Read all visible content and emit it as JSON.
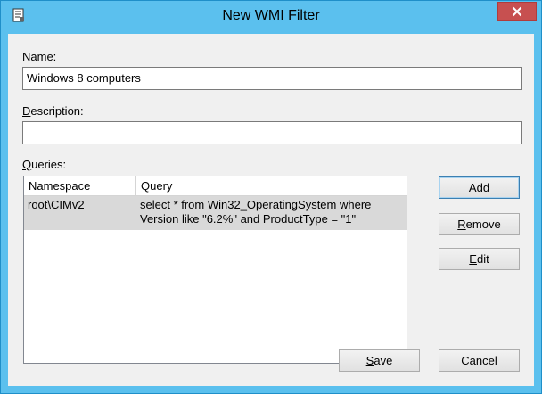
{
  "window": {
    "title": "New WMI Filter",
    "close_label": "✕"
  },
  "form": {
    "name_label_underlined": "N",
    "name_label_rest": "ame:",
    "name_value": "Windows 8 computers",
    "description_label_underlined": "D",
    "description_label_rest": "escription:",
    "description_value": "",
    "queries_label_underlined": "Q",
    "queries_label_rest": "ueries:"
  },
  "queries": {
    "columns": [
      "Namespace",
      "Query"
    ],
    "rows": [
      {
        "namespace": "root\\CIMv2",
        "query_line1": "select * from Win32_OperatingSystem  where",
        "query_line2": "Version like \"6.2%\" and ProductType = \"1\""
      }
    ]
  },
  "buttons": {
    "add_underlined": "A",
    "add_rest": "dd",
    "remove_underlined": "R",
    "remove_rest": "emove",
    "edit_underlined": "E",
    "edit_rest": "dit",
    "save_underlined": "S",
    "save_rest": "ave",
    "cancel": "Cancel"
  },
  "colors": {
    "title_bar": "#5bc0ee",
    "close_button": "#c75050",
    "selected_row": "#d9d9d9"
  }
}
